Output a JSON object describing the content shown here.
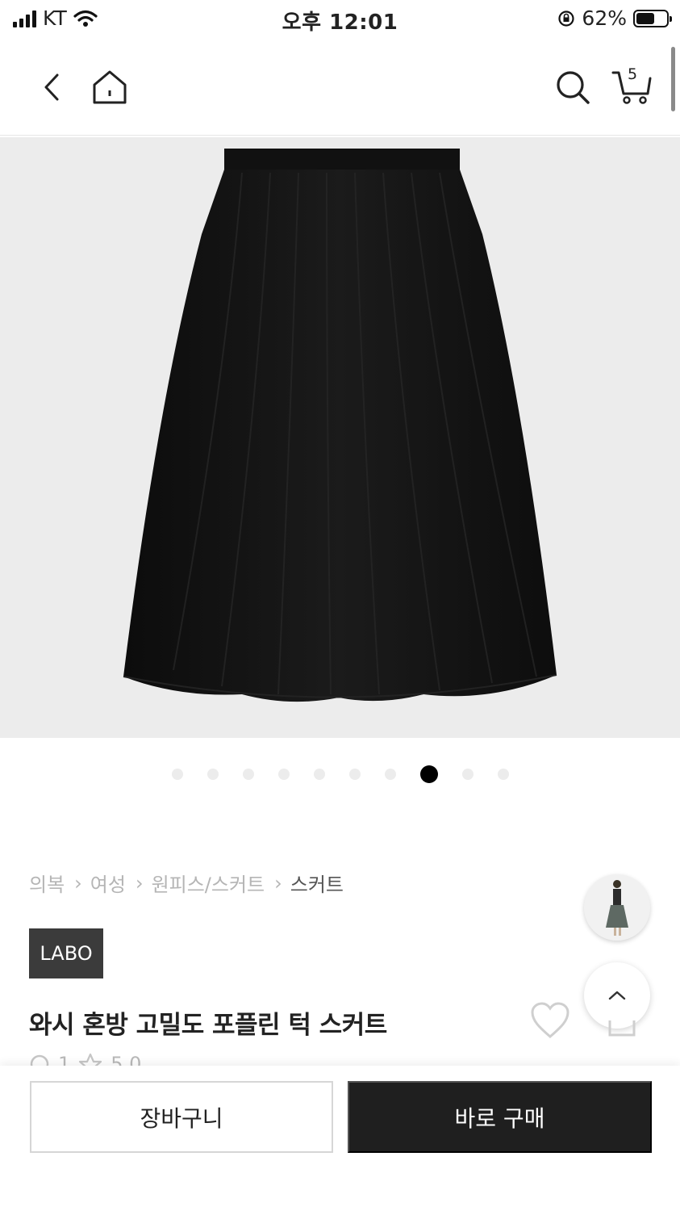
{
  "status_bar": {
    "carrier": "KT",
    "time": "오후 12:01",
    "battery_percent": "62%",
    "battery_level": 0.62
  },
  "header": {
    "back_icon": "chevron-left-icon",
    "home_icon": "home-icon",
    "search_icon": "search-icon",
    "cart_icon": "cart-icon",
    "cart_count": "5"
  },
  "gallery": {
    "total_images": 10,
    "active_index": 7
  },
  "breadcrumb": {
    "items": [
      "의복",
      "여성",
      "원피스/스커트",
      "스커트"
    ]
  },
  "product": {
    "brand": "LABO",
    "title": "와시 혼방 고밀도 포플린 턱 스커트",
    "review_count": "1",
    "rating": "5.0"
  },
  "actions": {
    "cart_label": "장바구니",
    "buy_label": "바로 구매"
  },
  "colors": {
    "accent": "#1f1f1f",
    "image_bg": "#ececec"
  }
}
